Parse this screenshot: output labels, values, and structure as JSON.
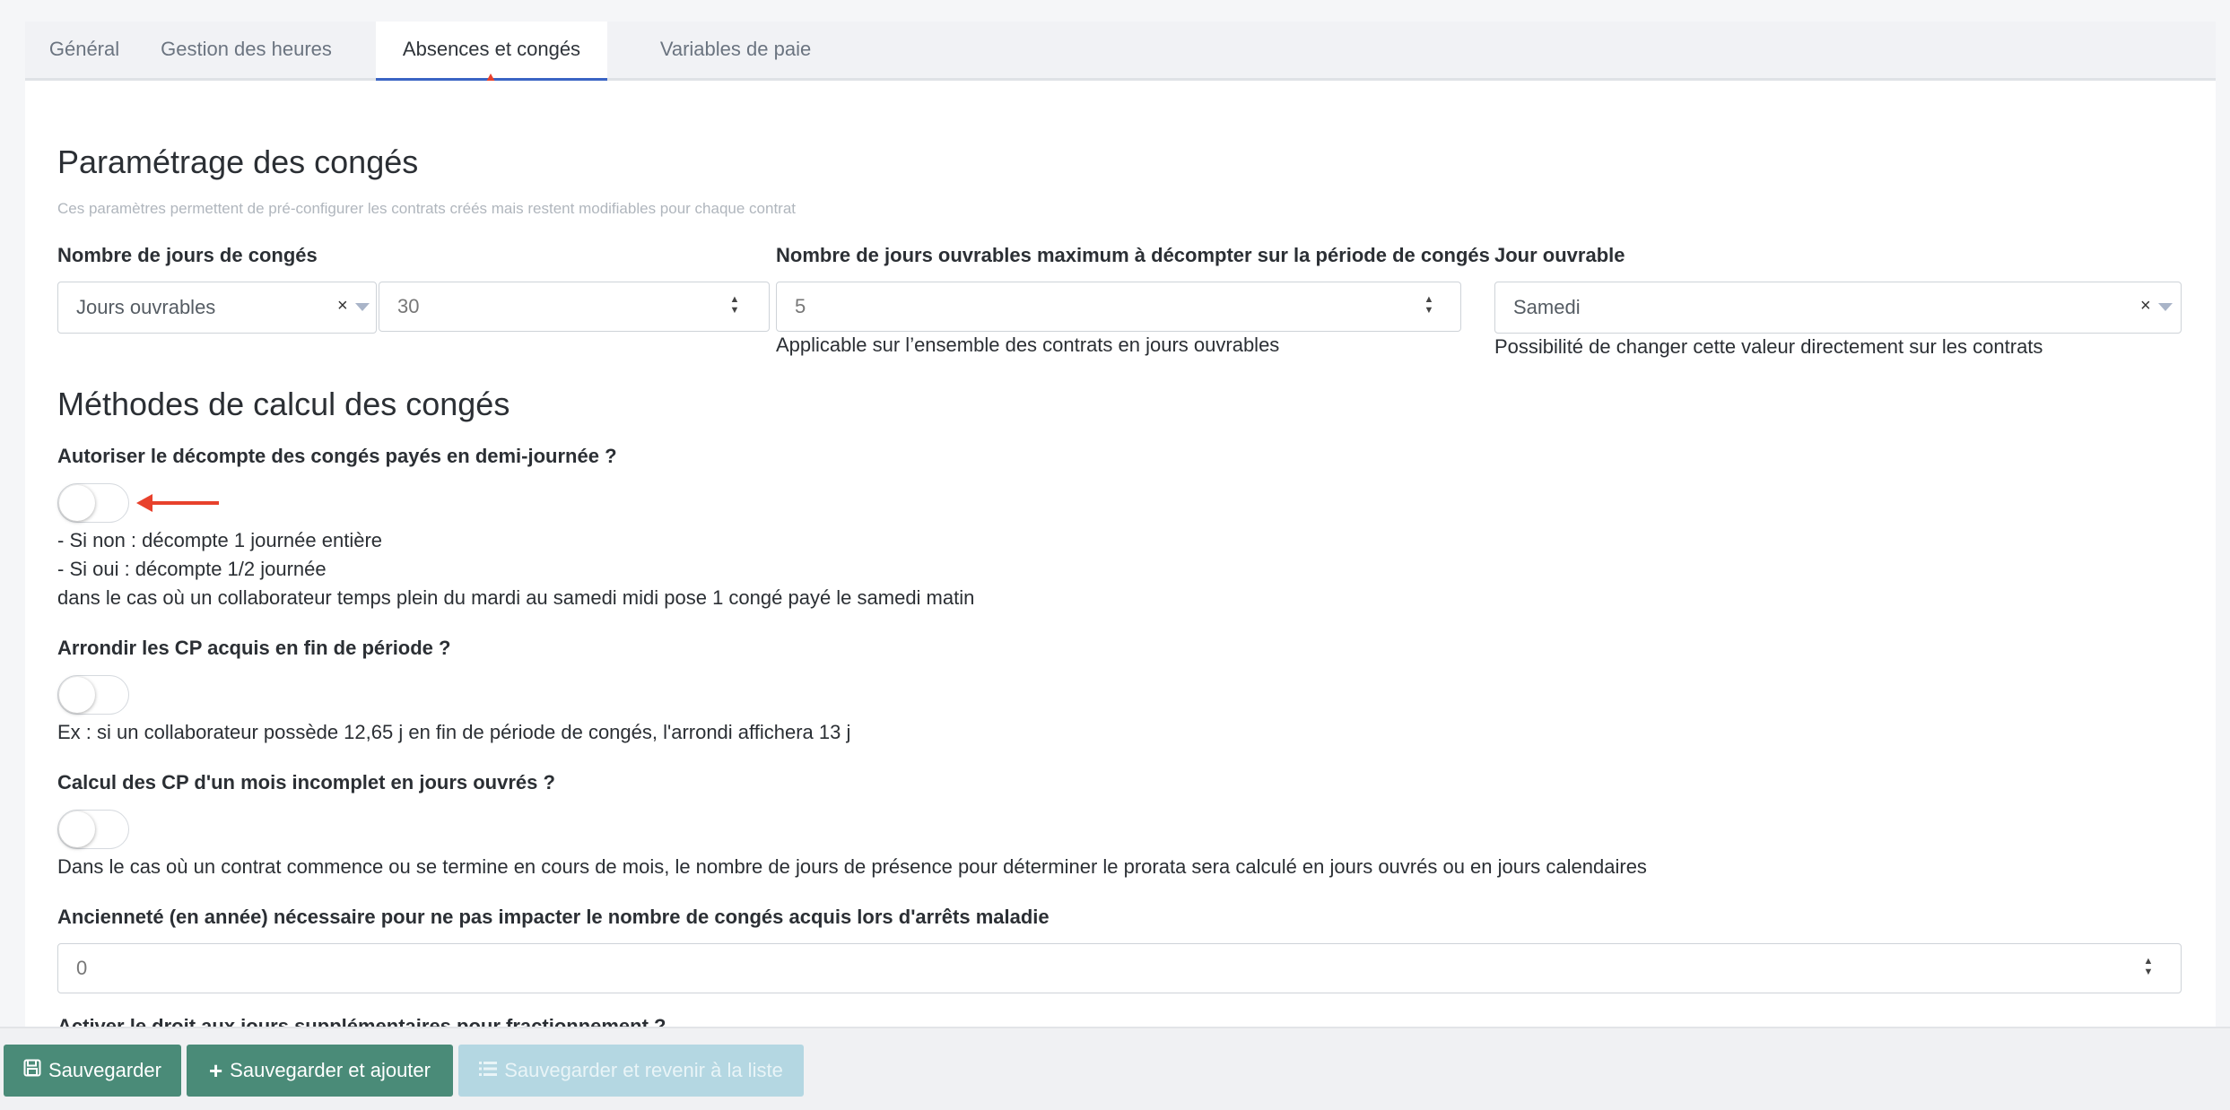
{
  "tabs": [
    {
      "label": "Général",
      "active": false
    },
    {
      "label": "Gestion des heures",
      "active": false
    },
    {
      "label": "Absences et congés",
      "active": true
    },
    {
      "label": "Variables de paie",
      "active": false
    }
  ],
  "section1": {
    "title": "Paramétrage des congés",
    "subtitle": "Ces paramètres permettent de pré-configurer les contrats créés mais restent modifiables pour chaque contrat",
    "days_label": "Nombre de jours de congés",
    "days_type": "Jours ouvrables",
    "days_value": "30",
    "max_days_label": "Nombre de jours ouvrables maximum à décompter sur la période de congés",
    "max_days_value": "5",
    "max_days_help": "Applicable sur l’ensemble des contrats en jours ouvrables",
    "working_day_label": "Jour ouvrable",
    "working_day_value": "Samedi",
    "working_day_help": "Possibilité de changer cette valeur directement sur les contrats"
  },
  "section2": {
    "title": "Méthodes de calcul des congés",
    "half_day_label": "Autoriser le décompte des congés payés en demi-journée ?",
    "half_day_help_1": "- Si non : décompte 1 journée entière",
    "half_day_help_2": "- Si oui : décompte 1/2 journée",
    "half_day_help_3": "dans le cas où un collaborateur temps plein du mardi au samedi midi pose 1 congé payé le samedi matin",
    "round_label": "Arrondir les CP acquis en fin de période ?",
    "round_help": "Ex : si un collaborateur possède 12,65 j en fin de période de congés, l'arrondi affichera 13 j",
    "incomplete_label": "Calcul des CP d'un mois incomplet en jours ouvrés ?",
    "incomplete_help": "Dans le cas où un contrat commence ou se termine en cours de mois, le nombre de jours de présence pour déterminer le prorata sera calculé en jours ouvrés ou en jours calendaires",
    "seniority_label": "Ancienneté (en année) nécessaire pour ne pas impacter le nombre de congés acquis lors d'arrêts maladie",
    "seniority_value": "0",
    "split_label": "Activer le droit aux jours supplémentaires pour fractionnement ?",
    "toggles": {
      "half_day": false,
      "round": false,
      "incomplete": false
    }
  },
  "footer": {
    "save": "Sauvegarder",
    "save_add": "Sauvegarder et ajouter",
    "save_back": "Sauvegarder et revenir à la liste"
  },
  "colors": {
    "accent": "#3a64c4",
    "button": "#4a8b78",
    "annotation_arrow": "#e8412c"
  },
  "icons": [
    "save-icon",
    "plus-icon",
    "list-icon",
    "clear-icon",
    "chevron-down-icon",
    "spinner-icon"
  ]
}
